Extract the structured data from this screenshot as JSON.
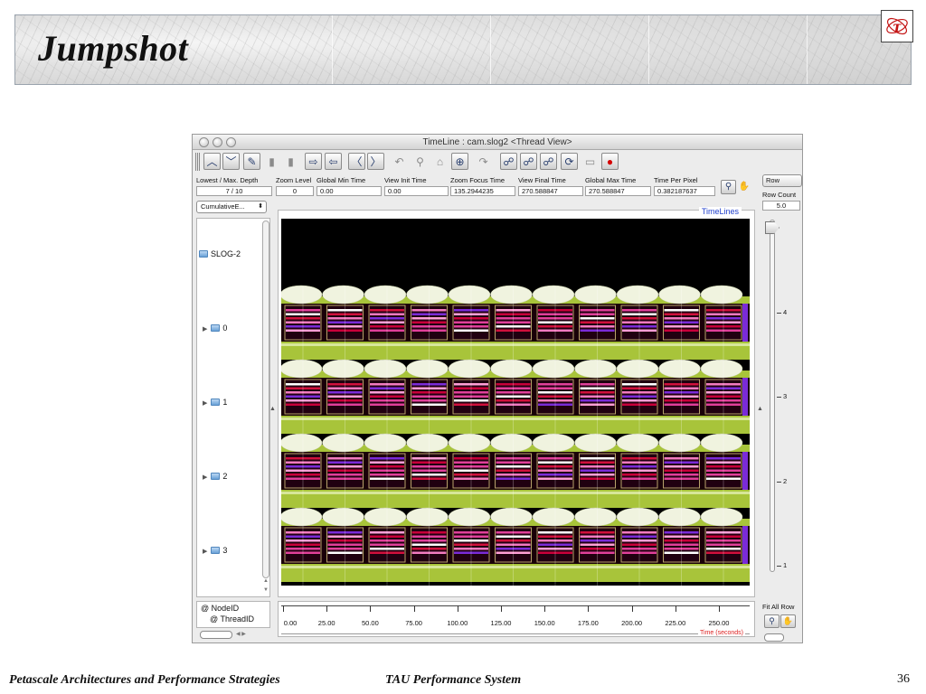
{
  "slide": {
    "title": "Jumpshot",
    "footer_left": "Petascale Architectures and Performance Strategies",
    "footer_center": "TAU Performance System",
    "page_number": "36",
    "logo_letter": "τ"
  },
  "window": {
    "title": "TimeLine : cam.slog2  <Thread View>"
  },
  "toolbar_icons": [
    "scroll-up-icon",
    "scroll-down-icon",
    "edit-icon",
    "delete-icon",
    "trash-icon",
    "jump-right-icon",
    "jump-left-icon",
    "backward-icon",
    "forward-icon",
    "undo-icon",
    "zoom-out-icon",
    "home-icon",
    "zoom-in-icon",
    "redo-icon",
    "search-backward-icon",
    "search-icon",
    "search-forward-icon",
    "refresh-icon",
    "print-icon",
    "stop-icon"
  ],
  "info": {
    "headers": [
      "Lowest / Max. Depth",
      "Zoom Level",
      "Global Min Time",
      "View  Init Time",
      "Zoom Focus Time",
      "View Final Time",
      "Global Max Time",
      "Time Per Pixel"
    ],
    "values": [
      "7 / 10",
      "0",
      "0.00",
      "0.00",
      "135.2944235",
      "270.588847",
      "270.588847",
      "0.382187637"
    ]
  },
  "dropdown": {
    "value": "CumulativeE..."
  },
  "tree": {
    "root": "SLOG-2",
    "nodes": [
      "0",
      "1",
      "2",
      "3"
    ]
  },
  "legend": {
    "line1": "@ NodeID",
    "line2": "@ ThreadID"
  },
  "timeline": {
    "label": "TimeLines"
  },
  "axis": {
    "ticks": [
      "0.00",
      "25.00",
      "50.00",
      "75.00",
      "100.00",
      "125.00",
      "150.00",
      "175.00",
      "200.00",
      "225.00",
      "250.00"
    ],
    "title": "Time (seconds)"
  },
  "row_panel": {
    "row_label": "Row",
    "row_count_label": "Row Count",
    "row_count_value": "5.0",
    "slider_ticks": [
      "4",
      "3",
      "2",
      "1"
    ],
    "fit_all_label": "Fit All Row"
  },
  "colors": {
    "canvas_bg": "#000000",
    "green_band": "#a8c43a",
    "ellipse": "#f0f3df",
    "magenta": "#e0409a",
    "red": "#d0103c",
    "purple": "#7a2bd8",
    "axis_title": "#dd2222",
    "timelines_label": "#1f3fcc"
  }
}
